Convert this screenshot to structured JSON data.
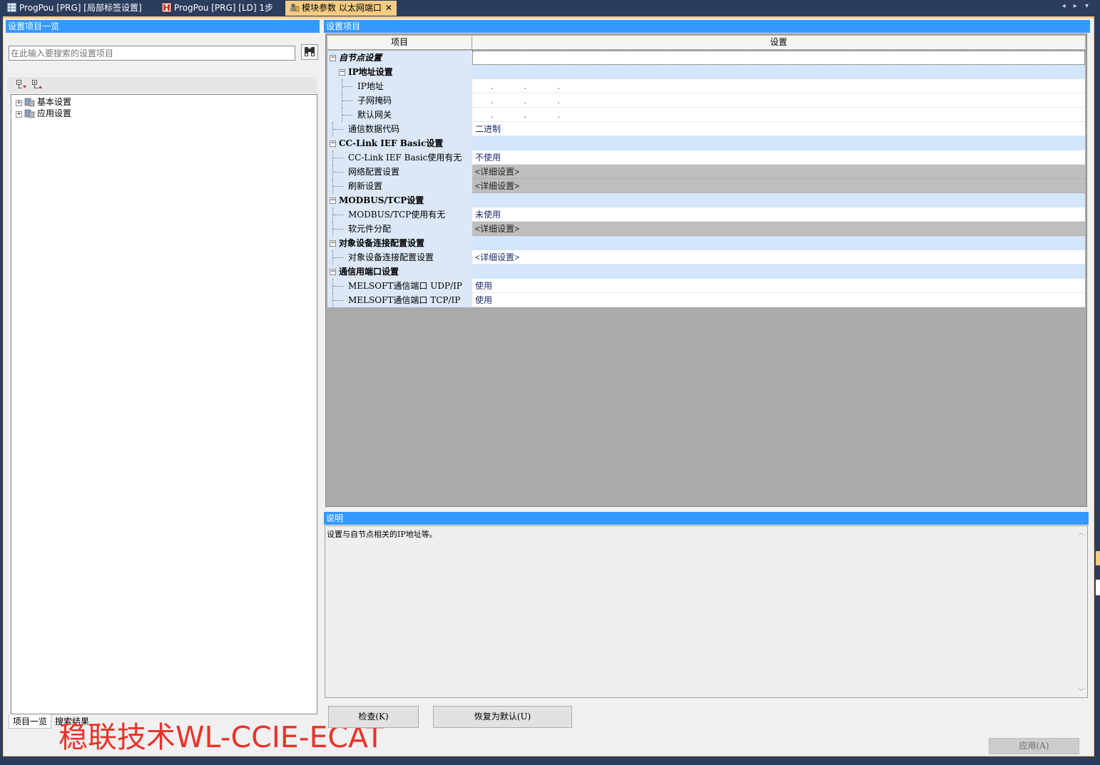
{
  "tabs": [
    {
      "label": "ProgPou [PRG] [局部标签设置]",
      "icon": "grid-icon",
      "active": false
    },
    {
      "label": "ProgPou [PRG] [LD] 1步",
      "icon": "ladder-icon",
      "active": false
    },
    {
      "label": "模块参数 以太网端口",
      "icon": "module-param-icon",
      "active": true,
      "close": "✕"
    }
  ],
  "tab_nav": "◂ ▸ ▾",
  "left_panel": {
    "title": "设置项目一览",
    "search_placeholder": "在此输入要搜索的设置项目",
    "tree": [
      {
        "label": "基本设置",
        "expander": "+"
      },
      {
        "label": "应用设置",
        "expander": "+"
      }
    ],
    "bottom_tabs": [
      "项目一览",
      "搜索结果"
    ],
    "watermark": "稳联技术WL-CCIE-ECAT"
  },
  "grid": {
    "title": "设置项目",
    "columns": [
      "项目",
      "设置"
    ],
    "rows": [
      {
        "type": "group",
        "name": "自节点设置",
        "value": "",
        "indent": 0
      },
      {
        "type": "group",
        "name": "IP地址设置",
        "value": "",
        "indent": 1
      },
      {
        "type": "item",
        "name": "IP地址",
        "value": ".    .    .",
        "indent": 2,
        "ip": true
      },
      {
        "type": "item",
        "name": "子网掩码",
        "value": ".    .    .",
        "indent": 2,
        "ip": true
      },
      {
        "type": "item",
        "name": "默认网关",
        "value": ".    .    .",
        "indent": 2,
        "ip": true
      },
      {
        "type": "item",
        "name": "通信数据代码",
        "value": "二进制",
        "indent": 1
      },
      {
        "type": "group",
        "name": "CC-Link IEF Basic设置",
        "value": "",
        "indent": 0
      },
      {
        "type": "item",
        "name": "CC-Link IEF Basic使用有无",
        "value": "不使用",
        "indent": 1
      },
      {
        "type": "detail",
        "name": "网络配置设置",
        "value": "<详细设置>",
        "indent": 1
      },
      {
        "type": "detail",
        "name": "刷新设置",
        "value": "<详细设置>",
        "indent": 1
      },
      {
        "type": "group",
        "name": "MODBUS/TCP设置",
        "value": "",
        "indent": 0
      },
      {
        "type": "item",
        "name": "MODBUS/TCP使用有无",
        "value": "未使用",
        "indent": 1
      },
      {
        "type": "detail",
        "name": "软元件分配",
        "value": "<详细设置>",
        "indent": 1
      },
      {
        "type": "group",
        "name": "对象设备连接配置设置",
        "value": "",
        "indent": 0
      },
      {
        "type": "item",
        "name": "对象设备连接配置设置",
        "value": "<详细设置>",
        "indent": 1
      },
      {
        "type": "group",
        "name": "通信用端口设置",
        "value": "",
        "indent": 0
      },
      {
        "type": "item",
        "name": "MELSOFT通信端口 UDP/IP",
        "value": "使用",
        "indent": 1
      },
      {
        "type": "item",
        "name": "MELSOFT通信端口 TCP/IP",
        "value": "使用",
        "indent": 1
      }
    ]
  },
  "description": {
    "title": "说明",
    "text": "设置与自节点相关的IP地址等。"
  },
  "buttons": {
    "check": "检查(K)",
    "restore_default": "恢复为默认(U)",
    "apply": "应用(A)"
  },
  "colors": {
    "title_bar": "#3399ff",
    "active_tab": "#f5cc84",
    "tree_column": "#dce8f7",
    "detail_cell": "#bebebe",
    "watermark": "#e8332a"
  }
}
